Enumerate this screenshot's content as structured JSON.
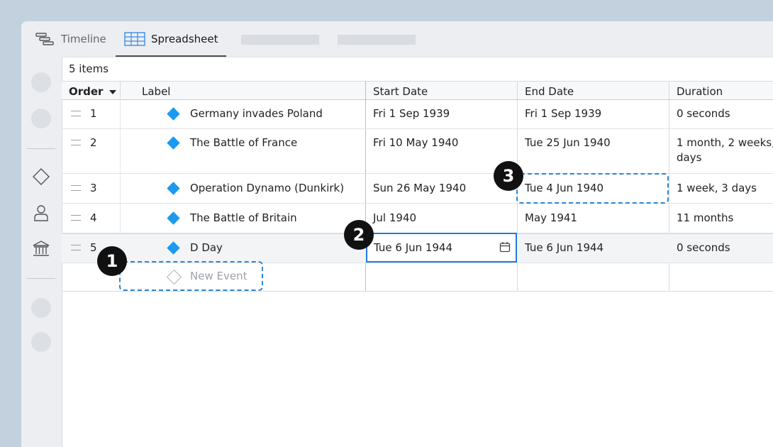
{
  "tabs": {
    "timeline": "Timeline",
    "spreadsheet": "Spreadsheet"
  },
  "items_count": "5 items",
  "columns": {
    "order": "Order",
    "label": "Label",
    "start": "Start Date",
    "end": "End Date",
    "duration": "Duration"
  },
  "rows": [
    {
      "order": "1",
      "label": "Germany invades Poland",
      "start": "Fri 1 Sep 1939",
      "end": "Fri 1 Sep 1939",
      "duration": "0 seconds"
    },
    {
      "order": "2",
      "label": "The Battle of France",
      "start": "Fri 10 May 1940",
      "end": "Tue 25 Jun 1940",
      "duration": "1 month, 2 weeks,",
      "duration2": "days"
    },
    {
      "order": "3",
      "label": "Operation Dynamo (Dunkirk)",
      "start": "Sun 26 May 1940",
      "end": "Tue 4 Jun 1940",
      "duration": "1 week, 3 days"
    },
    {
      "order": "4",
      "label": "The Battle of Britain",
      "start": "Jul 1940",
      "end": "May 1941",
      "duration": "11 months"
    },
    {
      "order": "5",
      "label": "D Day",
      "start": "Tue 6 Jun 1944",
      "end": "Tue 6 Jun 1944",
      "duration": "0 seconds"
    }
  ],
  "new_event": "New Event",
  "callouts": [
    "1",
    "2",
    "3"
  ],
  "colors": {
    "accent": "#1a9af0",
    "selection": "#1f7ae0",
    "callout_dash": "#2a86d6"
  },
  "icons": [
    "timeline-icon",
    "spreadsheet-icon",
    "sort-down-icon",
    "milestone-icon",
    "person-icon",
    "bank-icon",
    "calendar-icon",
    "drag-handle-icon"
  ]
}
